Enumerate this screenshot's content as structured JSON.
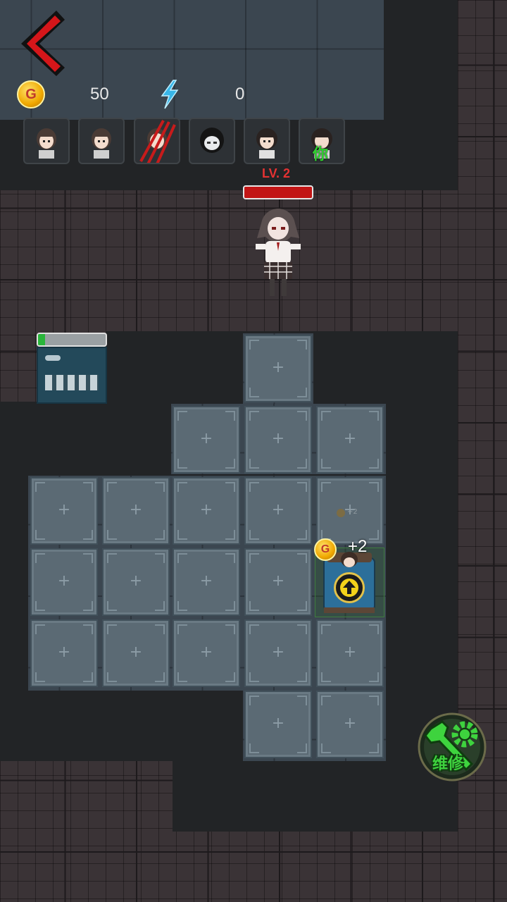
{
  "hud": {
    "gold_icon": "gold-coin-icon",
    "gold_coin_letter": "G",
    "gold_value": "50",
    "energy_icon": "lightning-icon",
    "energy_value": "0"
  },
  "back_button": {
    "icon": "chevron-left-icon"
  },
  "players": [
    {
      "icon": "player-portrait-icon",
      "label": ""
    },
    {
      "icon": "player-portrait-icon",
      "label": ""
    },
    {
      "icon": "player-portrait-clawed-icon",
      "label": ""
    },
    {
      "icon": "ghost-portrait-icon",
      "label": ""
    },
    {
      "icon": "player-portrait-icon",
      "label": ""
    },
    {
      "icon": "player-portrait-icon",
      "label": "你"
    }
  ],
  "ghost": {
    "level": "LV. 2",
    "hp_fraction": 1.0
  },
  "door": {
    "durability_fraction": 0.1,
    "icon": "door-icon"
  },
  "bed": {
    "gain": "+2",
    "small_gain": "+2",
    "upgrade_icon": "upgrade-arrow-icon",
    "coin_letter": "G"
  },
  "empty_tile_symbol": "+",
  "repair_button": {
    "label": "维修",
    "icon": "wrench-gear-icon"
  },
  "colors": {
    "accent_red": "#d21e1e",
    "repair_green": "#3ed33e",
    "gold": "#f2b100",
    "energy_blue": "#38b6e8"
  }
}
